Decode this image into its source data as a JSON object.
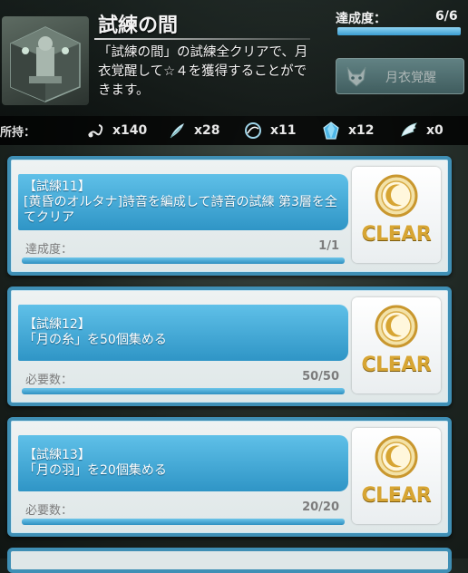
{
  "header": {
    "title": "試練の間",
    "description": "「試練の間」の試練全クリアで、月衣覚醒して☆４を獲得することができます。",
    "achievement_label": "達成度：",
    "achievement_value": "6/6",
    "achievement_progress": 1.0,
    "awaken_button_label": "月衣覚醒"
  },
  "inventory": {
    "label": "所持：",
    "items": [
      {
        "icon": "scorpion-icon",
        "count": "x140"
      },
      {
        "icon": "feather-icon",
        "count": "x28"
      },
      {
        "icon": "moon-thread-icon",
        "count": "x11"
      },
      {
        "icon": "blue-gem-icon",
        "count": "x12"
      },
      {
        "icon": "wing-icon",
        "count": "x0"
      }
    ]
  },
  "missions": [
    {
      "name": "【試練11】",
      "description": "[黄昏のオルタナ]詩音を編成して詩音の試練 第3層を全てクリア",
      "req_label": "達成度：",
      "req_value": "1/1",
      "progress": 1.0,
      "status": "CLEAR"
    },
    {
      "name": "【試練12】",
      "description": "「月の糸」を50個集める",
      "req_label": "必要数：",
      "req_value": "50/50",
      "progress": 1.0,
      "status": "CLEAR"
    },
    {
      "name": "【試練13】",
      "description": "「月の羽」を20個集める",
      "req_label": "必要数：",
      "req_value": "20/20",
      "progress": 1.0,
      "status": "CLEAR"
    }
  ],
  "colors": {
    "card_border": "#3f8fb5",
    "banner": "#3aa5d6",
    "clear_gold": "#d7a533"
  }
}
